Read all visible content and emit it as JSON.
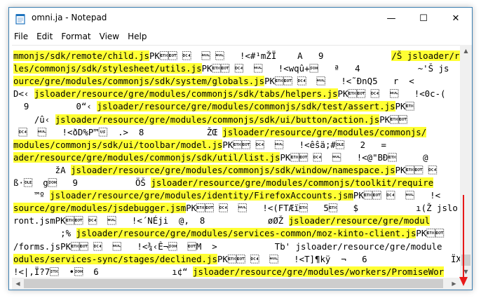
{
  "window": {
    "title": "omni.ja - Notepad"
  },
  "controls": {
    "minimize": "—",
    "maximize": "☐",
    "close": "✕"
  },
  "menu": [
    "File",
    "Edit",
    "Format",
    "View",
    "Help"
  ],
  "lines": [
    {
      "segments": [
        {
          "text": "mmonjs/sdk/remote/child.js",
          "hl": true
        },
        {
          "text": "PK\u0003\u0004 \u0014  \u0000 \u0000   !<#¹mŽÏ    A   9             ",
          "hl": false
        },
        {
          "text": "/Š jsloader/re",
          "hl": true
        }
      ]
    },
    {
      "segments": [
        {
          "text": "les/commonjs/sdk/stylesheet/utils.js",
          "hl": true
        },
        {
          "text": "PK\u0003\u0004 \u0014  \u0000   !<wqû+\u0001   ª   4           ~'Š js",
          "hl": false
        }
      ]
    },
    {
      "segments": [
        {
          "text": "ource/gre/modules/commonjs/sdk/system/globals.js",
          "hl": true
        },
        {
          "text": "PK\u0003\u0004 \u0014  \u0000   !<˜ÐnQ5   r  <",
          "hl": false
        }
      ]
    },
    {
      "segments": [
        {
          "text": "D<‹ ",
          "hl": false
        },
        {
          "text": "jsloader/resource/gre/modules/commonjs/sdk/tabs/helpers.js",
          "hl": true
        },
        {
          "text": "PK\u0003\u0004 \u0014  \u0000   !<0c-(",
          "hl": false
        }
      ]
    },
    {
      "segments": [
        {
          "text": "  9         0“‹ ",
          "hl": false
        },
        {
          "text": "jsloader/resource/gre/modules/commonjs/sdk/test/assert.js",
          "hl": true
        },
        {
          "text": "PK\u0003",
          "hl": false
        }
      ]
    },
    {
      "segments": [
        {
          "text": "    /û‹ ",
          "hl": false
        },
        {
          "text": "jsloader/resource/gre/modules/commonjs/sdk/ui/button/action.js",
          "hl": true
        },
        {
          "text": "PK\u0003\u0004",
          "hl": false
        }
      ]
    },
    {
      "segments": [
        {
          "text": " \u0014  \u0000   !<ðD%P™\u001f  .>  8            ŽŒ ",
          "hl": false
        },
        {
          "text": "jsloader/resource/gre/modules/commonjs/",
          "hl": true
        }
      ]
    },
    {
      "segments": [
        {
          "text": "modules/commonjs/sdk/ui/toolbar/model.js",
          "hl": true
        },
        {
          "text": "PK\u0003\u0004 \u0014  \u0000   !<êŝä;#\u0010   2   =          ",
          "hl": false
        }
      ]
    },
    {
      "segments": [
        {
          "text": "ader/resource/gre/modules/commonjs/sdk/util/list.js",
          "hl": true
        },
        {
          "text": "PK\u0003\u0004 \u0014  \u0000   !<@\"BÐ\u0003     @",
          "hl": false
        }
      ]
    },
    {
      "segments": [
        {
          "text": "        žA ",
          "hl": false
        },
        {
          "text": "jsloader/resource/gre/modules/commonjs/sdk/window/namespace.js",
          "hl": true
        },
        {
          "text": "PK\u0003\u0004 \u0014",
          "hl": false
        }
      ]
    },
    {
      "segments": [
        {
          "text": "ß·\u0010  g\u0001   9           ÖŠ ",
          "hl": false
        },
        {
          "text": "jsloader/resource/gre/modules/commonjs/toolkit/require",
          "hl": true
        }
      ]
    },
    {
      "segments": [
        {
          "text": "    ™º ",
          "hl": false
        },
        {
          "text": "jsloader/resource/gre/modules/identity/FirefoxAccounts.jsm",
          "hl": true
        },
        {
          "text": "PK\u0003\u0004 \u0014  \u0000   !<",
          "hl": false
        }
      ]
    },
    {
      "segments": [
        {
          "text": "source/gre/modules/jsdebugger.jsm",
          "hl": true
        },
        {
          "text": "PK\u0003\u0004 \u0014  \u0000   !<(FTÆï\u0003   5\u0003   $           ı(Ž jslo",
          "hl": false
        }
      ]
    },
    {
      "segments": [
        {
          "text": "ront.jsmPK\u0003\u0004 \u0014  \u0000   !<´NÉji  @,  8            øØŽ ",
          "hl": false
        },
        {
          "text": "jsloader/resource/gre/modul",
          "hl": true
        }
      ]
    },
    {
      "segments": [
        {
          "text": "         ;% ",
          "hl": false
        },
        {
          "text": "jsloader/resource/gre/modules/services-common/moz-kinto-client.js",
          "hl": true
        },
        {
          "text": "PK\u0003\u0004",
          "hl": false
        }
      ]
    },
    {
      "segments": [
        {
          "text": "/forms.jsPK\u0003\u0004 \u0014  \u0000   !<¾‹Ê¬\u0001  \u0004M  >           Tb' jsloader/resource/gre/module",
          "hl": false
        }
      ]
    },
    {
      "segments": [
        {
          "text": "odules/services-sync/stages/declined.js",
          "hl": true
        },
        {
          "text": "PK\u0003\u0004 \u0014  \u0000   !<T]¶kÿ  ¬   6                ÏX",
          "hl": false
        }
      ]
    },
    {
      "segments": [
        {
          "text": "!<|‚Ï?7\u0002  •\u0001  6              ı¢“ ",
          "hl": false
        },
        {
          "text": "jsloader/resource/gre/modules/workers/PromiseWor",
          "hl": true
        }
      ]
    }
  ],
  "annotation": {
    "color": "#e81919"
  }
}
